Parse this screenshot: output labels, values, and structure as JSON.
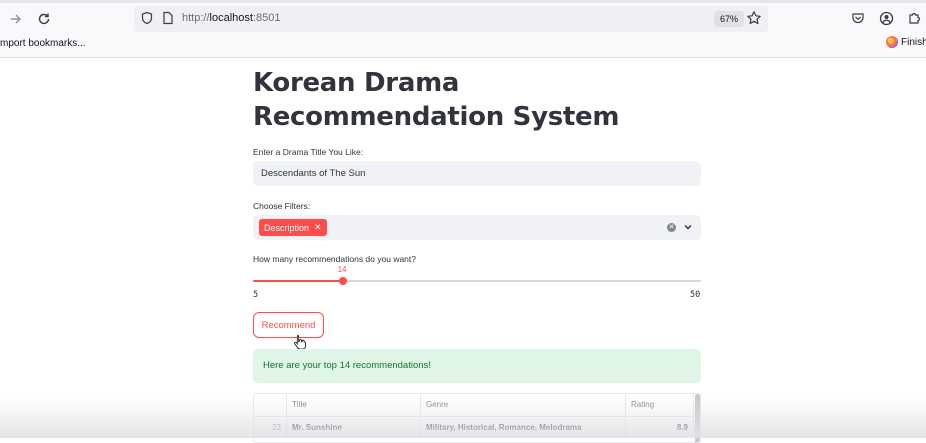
{
  "browser": {
    "url_prefix": "http://",
    "url_host": "localhost",
    "url_port": ":8501",
    "zoom": "67%",
    "bookmarks_label": "mport bookmarks...",
    "finish_label": "Finish"
  },
  "app": {
    "title": "Korean Drama Recommendation System",
    "drama_input": {
      "label": "Enter a Drama Title You Like:",
      "value": "Descendants of The Sun"
    },
    "filters": {
      "label": "Choose Filters:",
      "selected": [
        "Description"
      ]
    },
    "slider": {
      "label": "How many recommendations do you want?",
      "value": 14,
      "min": 5,
      "max": 50
    },
    "recommend_button": "Recommend",
    "success_message": "Here are your top 14 recommendations!",
    "table": {
      "columns": [
        "Title",
        "Genre",
        "Rating"
      ],
      "rows": [
        {
          "index": "23",
          "title": "Mr. Sunshine",
          "genre": "Military,  Historical,  Romance,  Melodrama",
          "rating": "8.9"
        }
      ]
    }
  },
  "colors": {
    "accent": "#ff4b4b",
    "success_bg": "#dff5e6",
    "success_text": "#177233"
  }
}
